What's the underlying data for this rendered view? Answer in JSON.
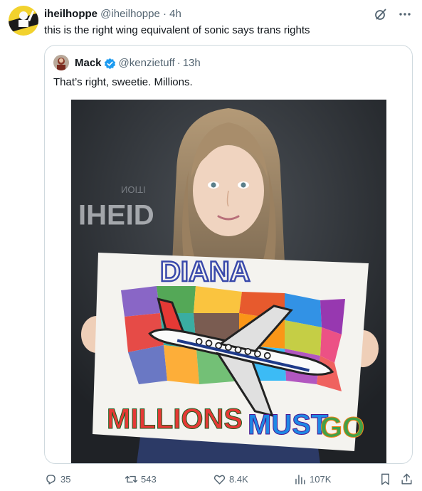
{
  "tweet": {
    "author_name": "iheilhoppe",
    "author_handle": "@iheilhoppe",
    "separator": "·",
    "time": "4h",
    "text": "this is the right wing equivalent of sonic says trans rights"
  },
  "quoted_tweet": {
    "author_name": "Mack",
    "author_handle": "@kenzietuff",
    "separator": "·",
    "time": "13h",
    "verified": true,
    "text": "That’s right, sweetie. Millions.",
    "image": {
      "sign_name": "DIANA",
      "sign_line1": "MILLIONS",
      "sign_line2": "MUST",
      "sign_line3": "GO",
      "backdrop_text": "IHEID",
      "backdrop_small": "NOITI"
    }
  },
  "actions": {
    "replies": "35",
    "reposts": "543",
    "likes": "8.4K",
    "views": "107K"
  },
  "icons": {
    "grok": "grok-icon",
    "more": "more-icon",
    "reply": "reply-icon",
    "repost": "repost-icon",
    "like": "heart-icon",
    "views": "views-icon",
    "bookmark": "bookmark-icon",
    "share": "share-icon"
  },
  "colors": {
    "text": "#0f1419",
    "secondary": "#536471",
    "border": "#cfd9de",
    "verified": "#1d9bf0"
  }
}
